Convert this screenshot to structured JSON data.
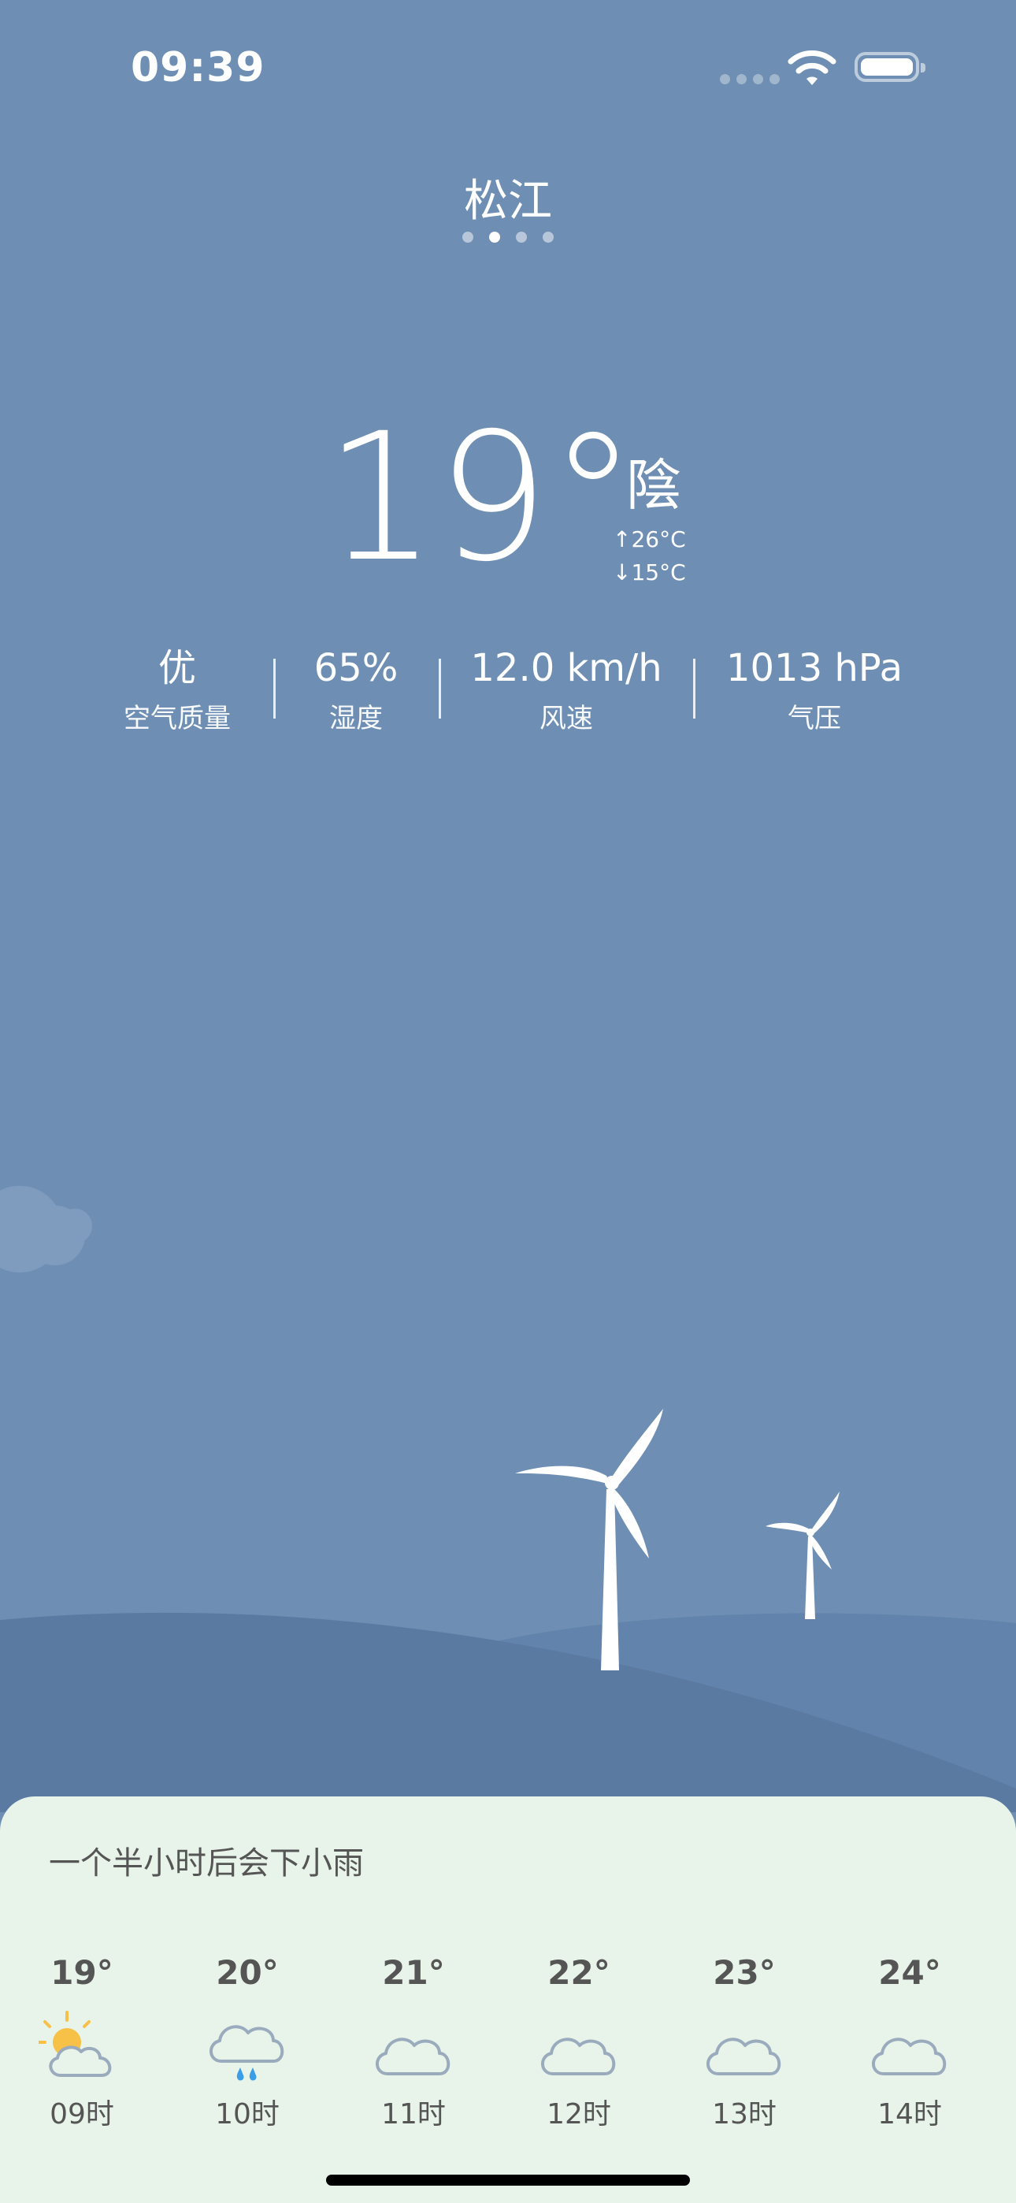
{
  "status_bar": {
    "time": "09:39",
    "icons": [
      "signal-dots-icon",
      "wifi-icon",
      "battery-icon"
    ]
  },
  "location": {
    "city": "松江",
    "page_count": 4,
    "active_page": 2
  },
  "current": {
    "temperature": "19°",
    "condition": "陰",
    "high": "↑26°C",
    "low": "↓15°C"
  },
  "stats": [
    {
      "value": "优",
      "label": "空气质量"
    },
    {
      "value": "65%",
      "label": "湿度"
    },
    {
      "value": "12.0 km/h",
      "label": "风速"
    },
    {
      "value": "1013 hPa",
      "label": "气压"
    }
  ],
  "forecast": {
    "note": "一个半小时后会下小雨",
    "hours": [
      {
        "temp": "19°",
        "hour": "09时",
        "icon": "partly-sunny-cloud-icon"
      },
      {
        "temp": "20°",
        "hour": "10时",
        "icon": "rain-cloud-icon"
      },
      {
        "temp": "21°",
        "hour": "11时",
        "icon": "cloud-icon"
      },
      {
        "temp": "22°",
        "hour": "12时",
        "icon": "cloud-icon"
      },
      {
        "temp": "23°",
        "hour": "13时",
        "icon": "cloud-icon"
      },
      {
        "temp": "24°",
        "hour": "14时",
        "icon": "cloud-icon"
      }
    ]
  },
  "colors": {
    "sky": "#6e8fb3",
    "hill_back": "#6283ab",
    "hill_front": "#5a7aa2",
    "panel": "#e8f4ea",
    "sun": "#f7c046",
    "rain": "#3d9ee8",
    "cloud_stroke": "#9aabbd"
  }
}
